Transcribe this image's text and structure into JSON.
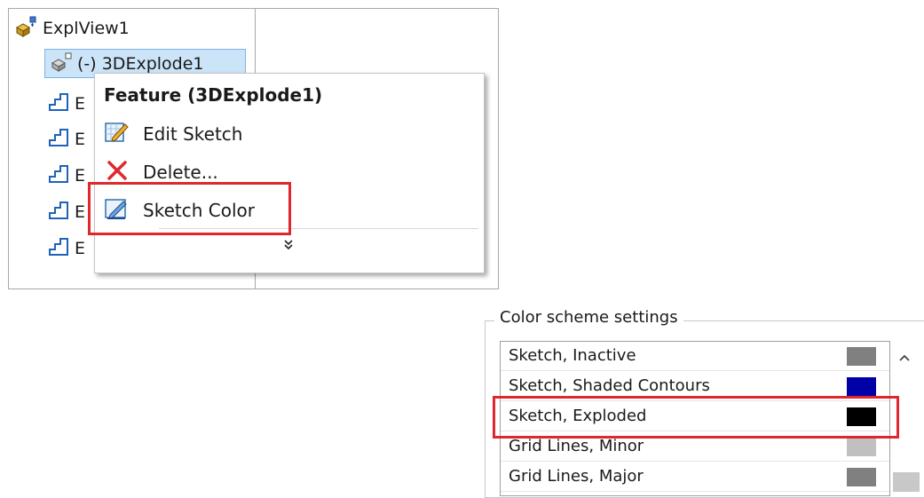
{
  "tree": {
    "root_label": "ExplView1",
    "selected_label": "(-) 3DExplode1",
    "step_labels": [
      "E",
      "E",
      "E",
      "E",
      "E"
    ]
  },
  "context_menu": {
    "title": "Feature (3DExplode1)",
    "items": [
      {
        "label": "Edit Sketch",
        "icon": "edit-sketch-icon"
      },
      {
        "label": "Delete...",
        "icon": "delete-x-icon"
      },
      {
        "label": "Sketch Color",
        "icon": "sketch-color-icon"
      }
    ],
    "expand_glyph": "»"
  },
  "color_scheme": {
    "legend": "Color scheme settings",
    "rows": [
      {
        "label": "Sketch, Inactive",
        "color": "#808080"
      },
      {
        "label": "Sketch, Shaded Contours",
        "color": "#0000a8"
      },
      {
        "label": "Sketch, Exploded",
        "color": "#000000"
      },
      {
        "label": "Grid Lines, Minor",
        "color": "#c0c0c0"
      },
      {
        "label": "Grid Lines, Major",
        "color": "#808080"
      }
    ]
  },
  "colors": {
    "highlight": "#e0272d",
    "selection": "#cce4f7"
  }
}
